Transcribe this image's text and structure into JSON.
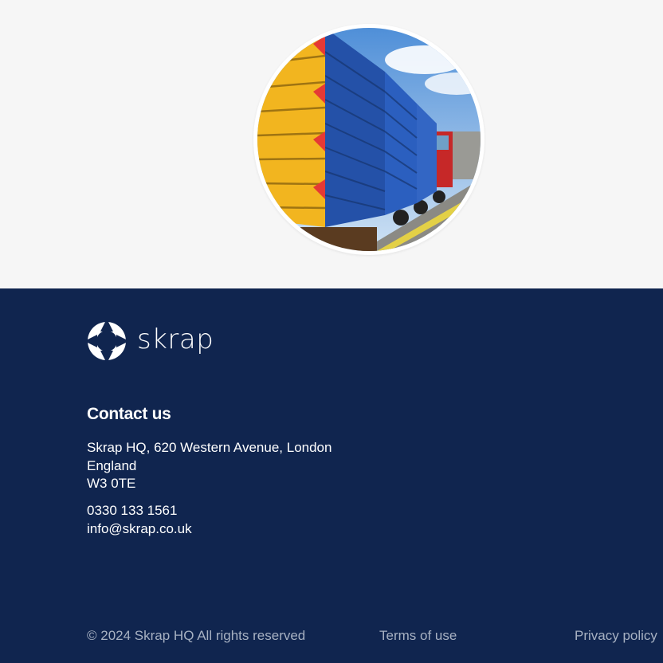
{
  "hero": {
    "photo_alt": "Blue and yellow skips stacked on a truck trailer"
  },
  "brand": {
    "name": "skrap",
    "color_footer": "#10254f",
    "color_text": "#ffffff",
    "color_muted": "#a7b1c2"
  },
  "contact": {
    "heading": "Contact us",
    "address_line1": "Skrap HQ, 620 Western Avenue, London",
    "address_line2": "England",
    "address_line3": "W3 0TE",
    "phone": "0330 133 1561",
    "email": "info@skrap.co.uk"
  },
  "footer_bottom": {
    "copyright": "© 2024 Skrap HQ All rights reserved",
    "terms_label": "Terms of use",
    "privacy_label": "Privacy policy"
  }
}
